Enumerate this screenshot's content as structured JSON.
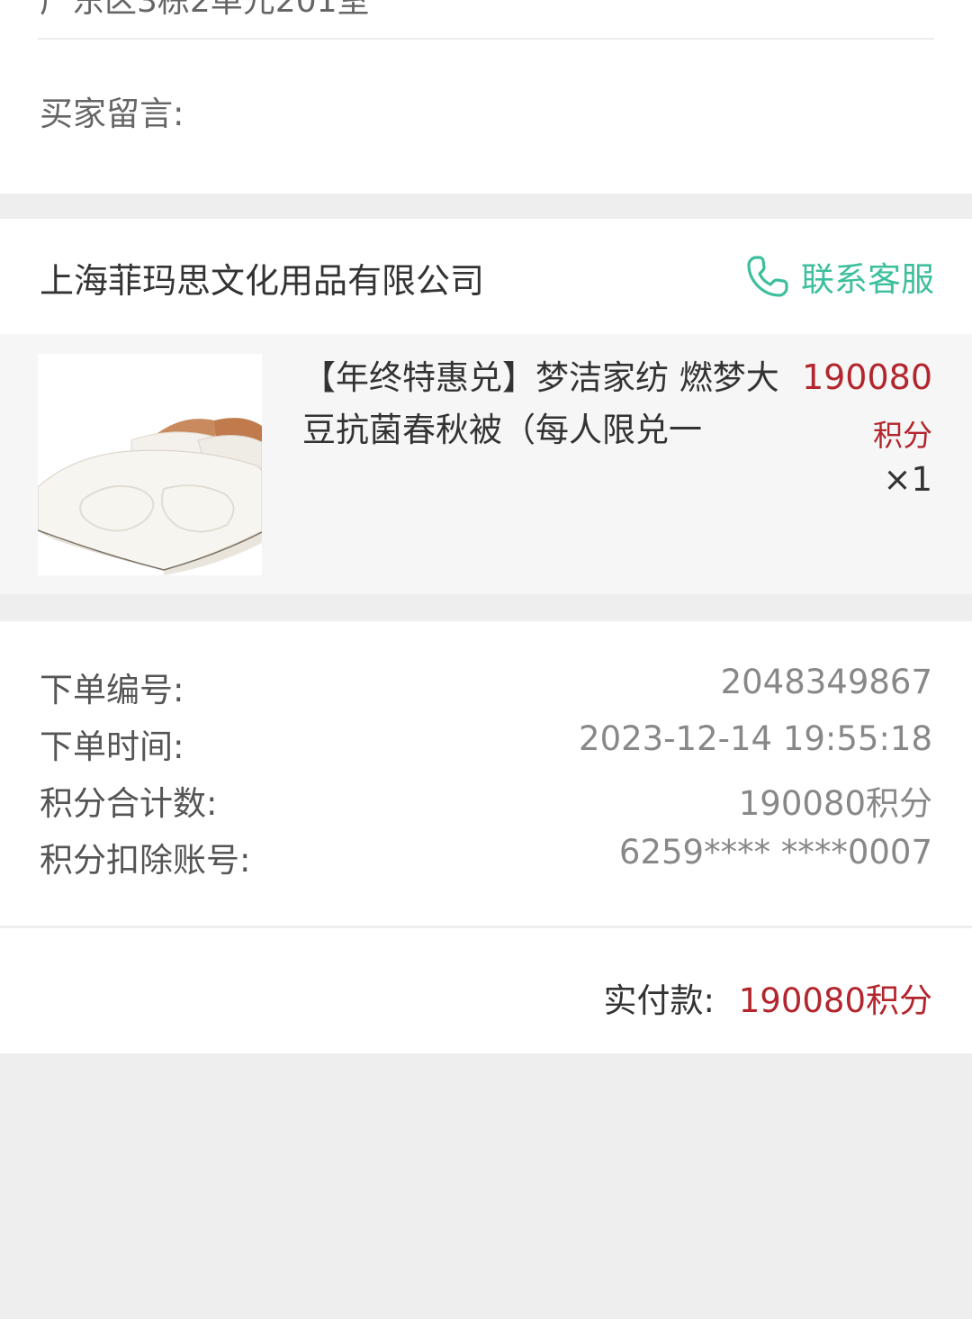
{
  "address": {
    "line_cut": "广东区3栋2单元201室"
  },
  "buyer_note": {
    "label": "买家留言:"
  },
  "shop": {
    "name": "上海菲玛思文化用品有限公司",
    "contact_label": "联系客服",
    "contact_icon": "phone-icon",
    "accent_color": "#3dbf9e"
  },
  "product": {
    "title": "【年终特惠兑】梦洁家纺 燃梦大豆抗菌春秋被（每人限兑一",
    "price": "190080",
    "price_unit": "积分",
    "quantity": "×1",
    "image": "quilt-product-image",
    "price_color": "#b3262d"
  },
  "order_info": {
    "rows": [
      {
        "label": "下单编号:",
        "value": "2048349867"
      },
      {
        "label": "下单时间:",
        "value": "2023-12-14 19:55:18"
      },
      {
        "label": "积分合计数:",
        "value": "190080积分"
      },
      {
        "label": "积分扣除账号:",
        "value": "6259**** ****0007"
      }
    ]
  },
  "total": {
    "label": "实付款:",
    "value": "190080积分"
  }
}
